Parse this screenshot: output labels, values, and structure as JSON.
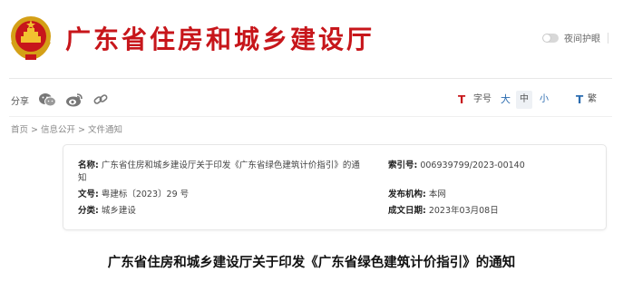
{
  "header": {
    "site_title": "广东省住房和城乡建设厅",
    "night_mode_label": "夜间护眼"
  },
  "share": {
    "label": "分享",
    "icons": [
      "wechat-icon",
      "weibo-icon",
      "link-icon"
    ]
  },
  "tools": {
    "font_size_label": "字号",
    "sizes": [
      "大",
      "中",
      "小"
    ],
    "selected_size": "中",
    "traditional_label": "繁"
  },
  "breadcrumb": [
    "首页",
    "信息公开",
    "文件通知"
  ],
  "info": {
    "name_label": "名称:",
    "name_value": "广东省住房和城乡建设厅关于印发《广东省绿色建筑计价指引》的通知",
    "index_label": "索引号:",
    "index_value": "006939799/2023-00140",
    "doc_label": "文号:",
    "doc_value": "粤建标〔2023〕29 号",
    "org_label": "发布机构:",
    "org_value": "本网",
    "category_label": "分类:",
    "category_value": "城乡建设",
    "date_label": "成文日期:",
    "date_value": "2023年03月08日"
  },
  "article": {
    "title": "广东省住房和城乡建设厅关于印发《广东省绿色建筑计价指引》的通知"
  },
  "colors": {
    "brand_red": "#c7161b",
    "link_blue": "#2b6cb0"
  }
}
